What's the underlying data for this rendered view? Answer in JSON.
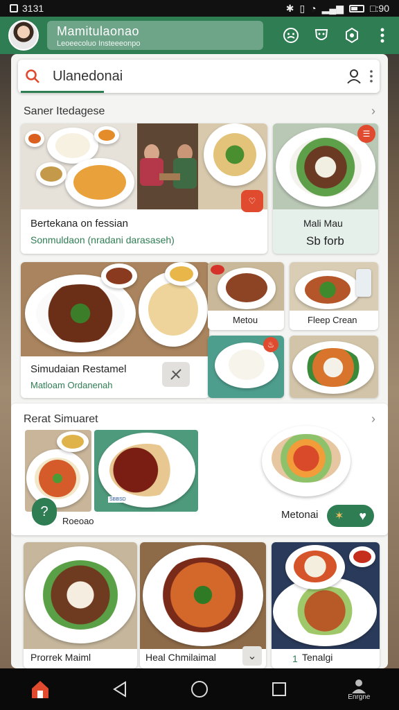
{
  "status_bar": {
    "time": "3131",
    "clock": "□:90"
  },
  "header": {
    "title": "Mamitulaonao",
    "subtitle": "Leoeecoluo Insteeeonpo"
  },
  "search": {
    "query": "Ulanedonai"
  },
  "section1": {
    "title": "Saner Itedagese"
  },
  "card1": {
    "title": "Bertekana on fessian",
    "subtitle": "Sonmuldaon (nradani darasaseh)"
  },
  "card2": {
    "line1": "Mali Mau",
    "line2": "Sb forb"
  },
  "card3": {
    "title": "Simudaian Restamel",
    "subtitle": "Matloam Ordanenah"
  },
  "card4": {
    "label": "Metou"
  },
  "card5": {
    "label": "Fleep Crean"
  },
  "section2": {
    "title": "Rerat Simuaret"
  },
  "card6": {
    "label": "Roeoao",
    "badge": "SBBSD"
  },
  "card7": {
    "label": "Metonai"
  },
  "bottom_row": {
    "item1": "Prorrek Maiml",
    "item2": "Heal Chmilaimal",
    "item3": "Tenalgi",
    "item3_prefix": "1"
  },
  "nav": {
    "profile_label": "Enrgne"
  },
  "colors": {
    "brand": "#2f7d53",
    "accent_red": "#e04a2e"
  }
}
